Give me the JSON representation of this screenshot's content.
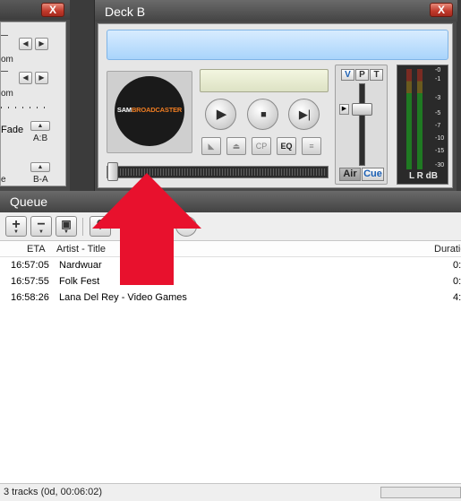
{
  "deck_a": {
    "close_label": "X",
    "frag_label_1": "om",
    "frag_label_2": "om",
    "fade_label": "Fade",
    "ab_label": "A:B",
    "ba_label": "B-A",
    "e_label": "e"
  },
  "deck_b": {
    "title": "Deck B",
    "close_label": "X",
    "logo_part1": "SAM",
    "logo_part2": "BROADCASTER",
    "buttons": {
      "play": "play",
      "stop": "stop",
      "next": "next",
      "cp_label": "CP",
      "eq_label": "EQ"
    },
    "vpt": [
      "V",
      "P",
      "T"
    ],
    "air_label": "Air",
    "cue_label": "Cue",
    "vu_ticks": [
      "-0",
      "-1",
      "-3",
      "-5",
      "-7",
      "-10",
      "-15",
      "-30"
    ],
    "vu_footer": "L R  dB"
  },
  "queue": {
    "title": "Queue",
    "columns": {
      "eta": "ETA",
      "artist_title": "Artist - Title",
      "duration": "Duratio"
    },
    "rows": [
      {
        "eta": "16:57:05",
        "title": "Nardwuar",
        "duration": "0:"
      },
      {
        "eta": "16:57:55",
        "title": "Folk Fest",
        "duration": "0:"
      },
      {
        "eta": "16:58:26",
        "title": "Lana Del Rey - Video Games",
        "duration": "4:"
      }
    ],
    "status": "3 tracks (0d, 00:06:02)"
  },
  "colors": {
    "arrow": "#e8112d",
    "title_bar": "#4a4a4a",
    "info_bar": "#a9d4fb",
    "close_button": "#c0392b"
  },
  "icons": {
    "add": "plus-icon",
    "remove": "minus-icon",
    "save": "floppy-icon",
    "search": "magnifier-icon"
  }
}
